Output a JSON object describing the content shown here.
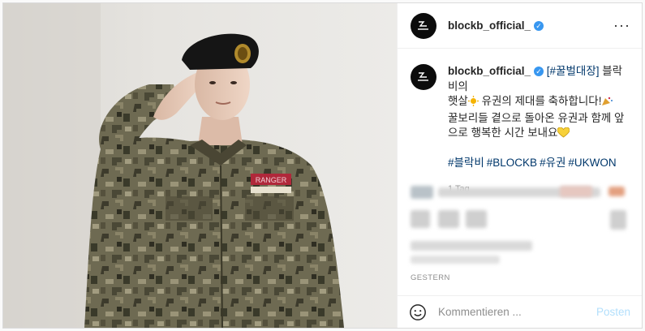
{
  "post": {
    "username": "blockb_official_",
    "verified_icon": "verified-badge-icon",
    "more_icon": "more-options-icon",
    "caption": {
      "tag": "[#꿀벌대장]",
      "line1": " 블락비의",
      "line2": "햇살",
      "line2b": " 유권의 제대를 축하합니다!",
      "line3": "꿀보리들 곁으로 돌아온 유권과 함께 앞",
      "line4": "으로 행복한 시간 보내요",
      "hashtags": [
        "#블락비",
        "#BLOCKB",
        "#유권",
        "#UKWON"
      ],
      "time": "1 Tag"
    },
    "comments_timestamp": "GESTERN",
    "comment_placeholder": "Kommentieren ...",
    "post_button": "Posten",
    "photo_patch_text": "RANGER",
    "colors": {
      "link": "#00376b",
      "verified": "#3897f0",
      "post_button": "#b2dffc",
      "muted": "#8e8e8e"
    }
  }
}
